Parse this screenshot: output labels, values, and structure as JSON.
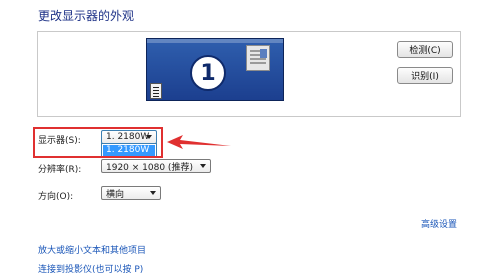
{
  "header": {
    "title": "更改显示器的外观"
  },
  "preview": {
    "monitor_number": "1"
  },
  "buttons": {
    "detect": "检测(C)",
    "identify": "识别(I)"
  },
  "display": {
    "label": "显示器(S):",
    "selected": "1. 2180W",
    "options": [
      "1. 2180W"
    ]
  },
  "resolution": {
    "label": "分辨率(R):",
    "selected": "1920 × 1080 (推荐)"
  },
  "orientation": {
    "label": "方向(O):",
    "selected": "横向"
  },
  "links": {
    "advanced": "高级设置",
    "enlarge": "放大或缩小文本和其他项目",
    "projector": "连接到投影仪(也可以按 P)"
  },
  "colors": {
    "title": "#1e3287",
    "link": "#1a56b8",
    "highlight": "#e03030",
    "selection": "#3399ff",
    "monitor_blue": "#1c3f8f"
  }
}
